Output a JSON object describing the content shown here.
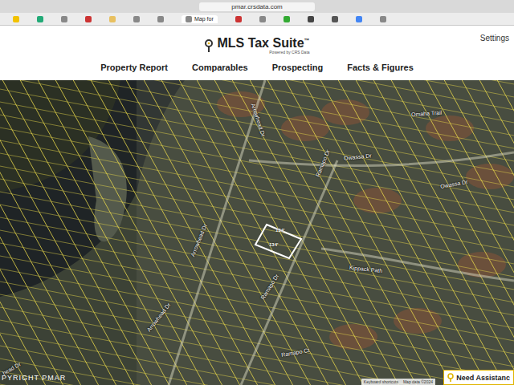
{
  "browser": {
    "url": "pmar.crsdata.com",
    "active_tab": "Map for"
  },
  "header": {
    "logo": {
      "title": "MLS Tax Suite",
      "mark": "™",
      "tagline": "Powered by CRS Data"
    },
    "settings": "Settings"
  },
  "nav": [
    {
      "label": "Property Report",
      "selected": false
    },
    {
      "label": "Comparables",
      "selected": false
    },
    {
      "label": "Prospecting",
      "selected": false
    },
    {
      "label": "Facts & Figures",
      "selected": false
    }
  ],
  "map": {
    "streets": [
      {
        "label": "Omaha Trail"
      },
      {
        "label": "Owassa Dr"
      },
      {
        "label": "Owassa Dr"
      },
      {
        "label": "Arrowhead Dr"
      },
      {
        "label": "Arrowhead Dr"
      },
      {
        "label": "Arrowhead Dr"
      },
      {
        "label": "Kippack Path"
      },
      {
        "label": "Ramapo Dr"
      },
      {
        "label": "Ramapo Dr"
      },
      {
        "label": "Ramapo Ct"
      },
      {
        "label": "head Dr"
      }
    ],
    "parcel": {
      "labels": [
        "134'",
        "134'"
      ]
    },
    "copyright": "PYRIGHT PMAR",
    "attribution": [
      "Keyboard shortcuts",
      "Map data ©2024"
    ]
  },
  "help": {
    "label": "Need Assistanc"
  }
}
